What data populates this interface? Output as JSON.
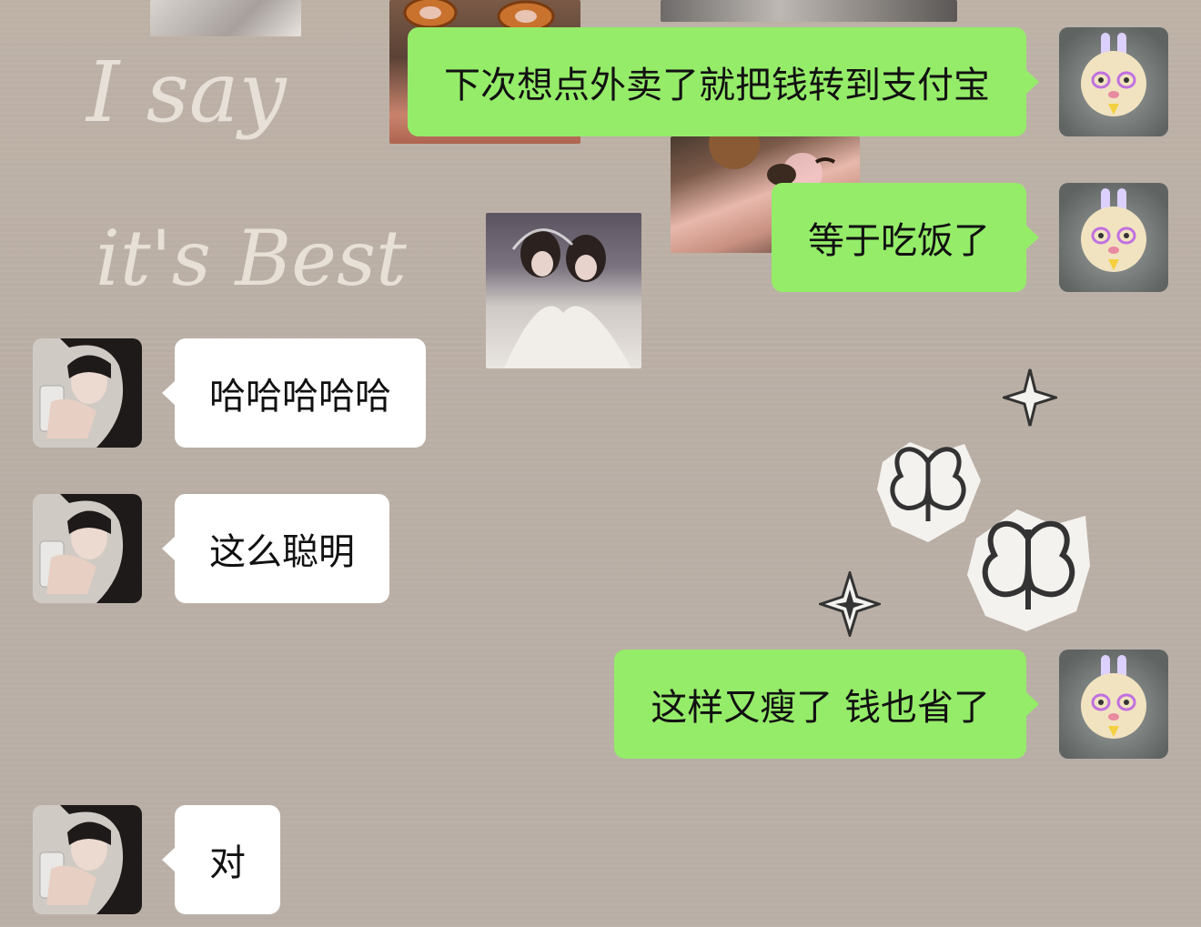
{
  "wallpaper": {
    "text_lines": [
      "I say",
      "it's Best"
    ]
  },
  "messages": [
    {
      "side": "sent",
      "text": "下次想点外卖了就把钱转到支付宝"
    },
    {
      "side": "sent",
      "text": "等于吃饭了"
    },
    {
      "side": "received",
      "text": "哈哈哈哈哈"
    },
    {
      "side": "received",
      "text": "这么聪明"
    },
    {
      "side": "sent",
      "text": "这样又瘦了 钱也省了"
    },
    {
      "side": "received",
      "text": "对"
    }
  ],
  "colors": {
    "sent_bubble": "#95ec69",
    "received_bubble": "#ffffff",
    "background": "#bbb0a6"
  },
  "icons": {
    "self_avatar": "rabbit-cartoon-avatar",
    "contact_avatar": "girl-photo-avatar",
    "decorations": [
      "butterfly-sticker-icon",
      "sparkle-star-icon"
    ]
  }
}
